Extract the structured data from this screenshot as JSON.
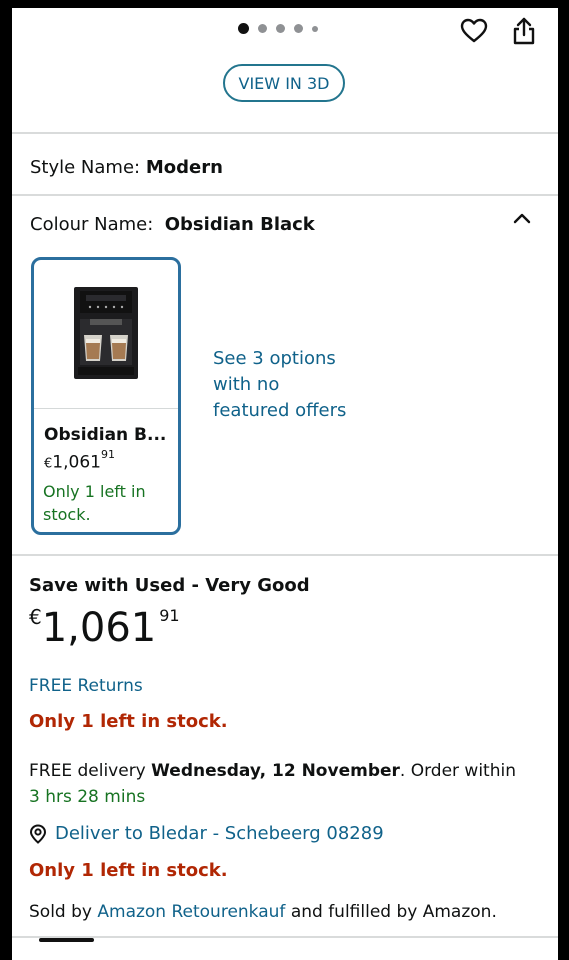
{
  "carousel": {
    "total_dots": 5,
    "active_index": 0
  },
  "header": {
    "view_3d_label": "VIEW IN 3D"
  },
  "style_row": {
    "label": "Style Name:",
    "value": "Modern"
  },
  "colour_row": {
    "label": "Colour Name:",
    "value": "Obsidian Black"
  },
  "swatch": {
    "name": "Obsidian B...",
    "price_currency": "€",
    "price_whole": "1,061",
    "price_fraction": "91",
    "stock": "Only 1 left in stock."
  },
  "options_link": "See 3 options with no featured offers",
  "offer": {
    "heading": "Save with Used - Very Good",
    "price_currency": "€",
    "price_whole": "1,061",
    "price_fraction": "91",
    "free_returns": "FREE Returns",
    "stock_1": "Only 1 left in stock.",
    "delivery_prefix": "FREE delivery",
    "delivery_date": "Wednesday, 12 November",
    "delivery_suffix": ". Order within",
    "delivery_countdown": "3 hrs 28 mins",
    "deliver_to": "Deliver to Bledar - Schebeerg 08289",
    "stock_2": "Only 1 left in stock.",
    "sold_by_prefix": "Sold by",
    "seller": "Amazon Retourenkauf",
    "sold_by_suffix": "and fulfilled by Amazon."
  },
  "colors": {
    "link": "#10628a",
    "stock_green": "#177322",
    "stock_red": "#b12704",
    "swatch_border": "#2b6f9e"
  }
}
